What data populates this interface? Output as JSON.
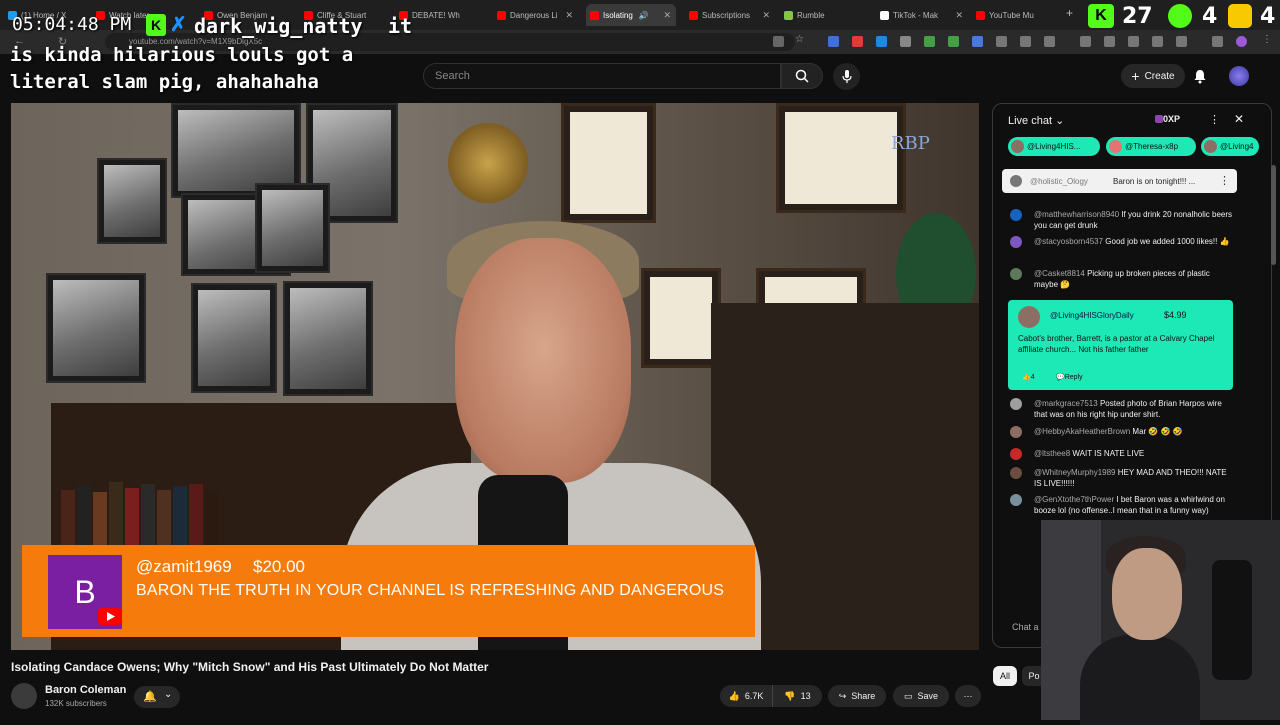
{
  "browser": {
    "tabs": [
      {
        "label": "(1) Home / X",
        "favicon_color": "#1d9bf0"
      },
      {
        "label": "Watch later",
        "favicon_color": "#ff0000"
      },
      {
        "label": "Owen Benjam",
        "favicon_color": "#ff0000"
      },
      {
        "label": "Cliffe & Stuart",
        "favicon_color": "#ff0000"
      },
      {
        "label": "DEBATE! Wh",
        "favicon_color": "#ff0000"
      },
      {
        "label": "Dangerous Li",
        "favicon_color": "#ff0000"
      },
      {
        "label": "Isolating",
        "favicon_color": "#ff0000"
      },
      {
        "label": "Subscriptions",
        "favicon_color": "#ff0000"
      },
      {
        "label": "Rumble",
        "favicon_color": "#85c742"
      },
      {
        "label": "TikTok - Mak",
        "favicon_color": "#ffffff"
      },
      {
        "label": "YouTube Mu",
        "favicon_color": "#ff0000"
      }
    ],
    "url": "youtube.com/watch?v=M1X9bDlgX5c"
  },
  "overlay": {
    "clock": "05:04:48 PM",
    "chat_user": "dark_wig_natty",
    "chat_word": "it",
    "chat_message": "is kinda hilarious louls got a literal slam pig, ahahahaha",
    "counter_1": "27",
    "counter_2": "4",
    "counter_3": "4"
  },
  "youtube": {
    "search_placeholder": "Search",
    "create_label": "Create",
    "video_title": "Isolating Candace Owens; Why \"Mitch Snow\" and His Past Ultimately Do Not Matter",
    "channel_name": "Baron Coleman",
    "subscribers": "132K subscribers",
    "likes": "6.7K",
    "dislikes": "13",
    "share_label": "Share",
    "save_label": "Save",
    "filter_all": "All",
    "filter_po": "Po"
  },
  "superchat": {
    "avatar_letter": "B",
    "name": "@zamit1969",
    "amount": "$20.00",
    "message": "BARON THE TRUTH IN YOUR CHANNEL IS REFRESHING AND DANGEROUS"
  },
  "chat": {
    "title": "Live chat",
    "xp": "0XP",
    "stickers": [
      {
        "label": "@Living4HIS...",
        "color": "#1de9b6"
      },
      {
        "label": "@Theresa-x8p",
        "color": "#1de9b6"
      },
      {
        "label": "@Living4",
        "color": "#1de9b6"
      }
    ],
    "pinned_author": "@holistic_Ology",
    "pinned_text": "Baron is on tonight!!! ...",
    "messages_top": [
      {
        "author": "@matthewharrison8940",
        "text": "If you drink 20 nonalholic beers you can get drunk",
        "avatar_color": "#1565c0"
      },
      {
        "author": "@stacyosborn4537",
        "text": "Good job we added 1000 likes!! 👍",
        "avatar_color": "#7e57c2"
      },
      {
        "author": "@Casket8814",
        "text": "Picking up broken pieces of plastic maybe 🤔",
        "avatar_color": "#5d7a5a"
      }
    ],
    "paid": {
      "author": "@Living4HISGloryDaily",
      "amount": "$4.99",
      "text": "Cabot's brother, Barrett, is a pastor at a Calvary Chapel affiliate church... Not his father father",
      "likes": "4",
      "reply": "Reply"
    },
    "messages_bottom": [
      {
        "author": "@markgrace7513",
        "text": "Posted photo of Brian Harpos wire that was on his right hip under shirt.",
        "avatar_color": "#9e9e9e"
      },
      {
        "author": "@HebbyAkaHeatherBrown",
        "text": "Mar 🤣 🤣 🤣",
        "avatar_color": "#8d6e63"
      },
      {
        "author": "@ltsthee8",
        "text": "WAIT IS NATE LIVE",
        "avatar_color": "#c62828"
      },
      {
        "author": "@WhitneyMurphy1989",
        "text": "HEY MAD AND THEO!!! NATE IS LIVE!!!!!!",
        "avatar_color": "#6d4c41"
      },
      {
        "author": "@GenXtothe7thPower",
        "text": "I bet Baron was a whirlwind on booze lol (no offense..I mean that in a funny way)",
        "avatar_color": "#78909c"
      }
    ],
    "input_placeholder": "Chat a"
  }
}
